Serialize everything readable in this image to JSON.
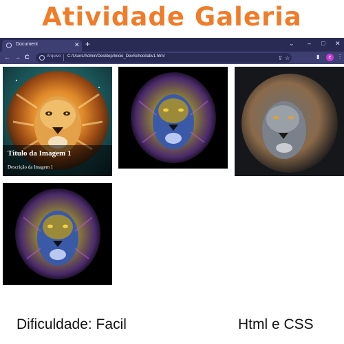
{
  "poster": {
    "title": "Atividade Galeria",
    "difficulty": "Dificuldade: Facil",
    "tech": "Html e CSS"
  },
  "browser": {
    "tab": {
      "title": "Document",
      "close": "✕",
      "new": "+"
    },
    "window": {
      "chevron": "⌄",
      "minimize": "–",
      "maximize": "□",
      "close": "✕"
    },
    "nav": {
      "back": "←",
      "forward": "→",
      "reload": "C"
    },
    "omnibox": {
      "scheme": "Arquivo",
      "url": "C:/Users/Admin/Desktop/Inicio_DevSchool/ativ1.html"
    },
    "actions": {
      "share": "⇪",
      "bookmark": "☆",
      "sidepanel": "▮",
      "profile": "e",
      "menu": "⋮"
    }
  },
  "gallery": {
    "cards": [
      {
        "title": "Titulo da Imagem 1",
        "description": "Descrição da Imagem 1",
        "image": "golden-lion-image"
      },
      {
        "image": "neon-lion-image"
      },
      {
        "image": "gray-lion-image"
      },
      {
        "image": "neon-lion-image"
      }
    ]
  },
  "colors": {
    "title_orange": "#f07c2a",
    "tab_strip": "#2a2b55",
    "toolbar": "#3d3f72",
    "profile_purple": "#c43bd6"
  }
}
